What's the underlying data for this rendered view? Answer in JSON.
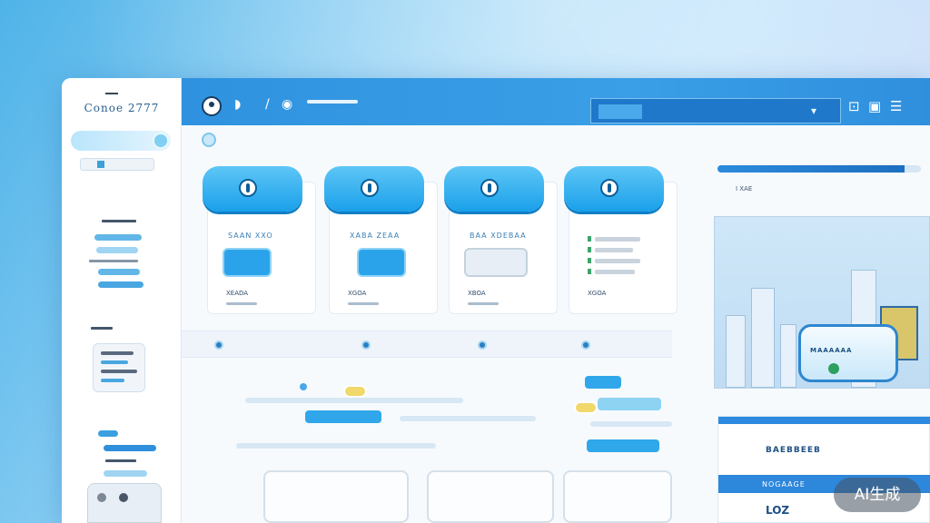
{
  "sidebar": {
    "brand": "Conoe 2777"
  },
  "header": {
    "icons": [
      "user-icon",
      "play-icon",
      "slash-icon",
      "eye-icon"
    ]
  },
  "subnav": {
    "items": [
      "",
      "",
      "",
      ""
    ]
  },
  "cards": [
    {
      "title": "SAAN XXO",
      "caption": "XEADA"
    },
    {
      "title": "XABA ZEAA",
      "caption": "XGOA"
    },
    {
      "title": "BAA XDEBAA",
      "caption": "XBOA"
    },
    {
      "title": "",
      "caption": "XGOA"
    }
  ],
  "right_panel": {
    "note": "I XAE",
    "device_label": "MAAAAAA",
    "section_title": "BAEBBEEB",
    "bar_label": "NOGAAGE",
    "footer_text": "LOZ"
  },
  "badge": {
    "label": "AI生成"
  },
  "colors": {
    "accent": "#2f92e0",
    "card_cap": "#1aa0ea",
    "highlight": "#f1d86a"
  }
}
